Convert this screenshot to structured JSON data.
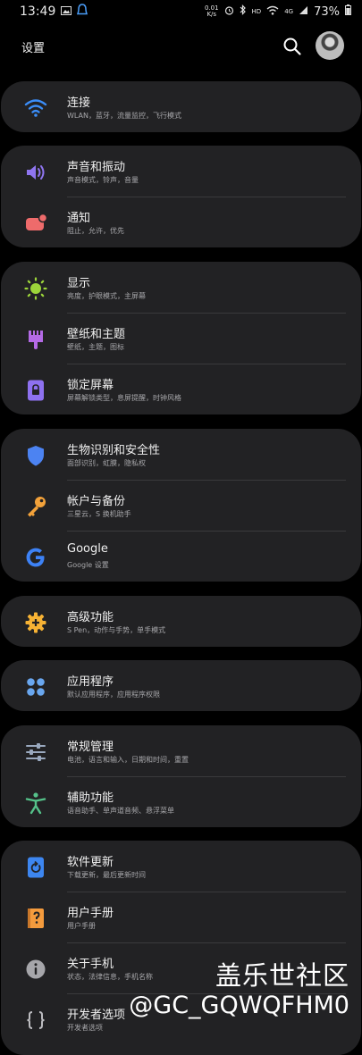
{
  "status_bar": {
    "time": "13:49",
    "net_speed_top": "0.01",
    "net_speed_bottom": "K/s",
    "hd": "HD",
    "signal": "4G",
    "battery": "73%"
  },
  "header": {
    "title": "设置"
  },
  "groups": [
    {
      "items": [
        {
          "label": "连接",
          "sub": "WLAN，蓝牙，流量监控，飞行模式",
          "icon": "wifi-icon",
          "color": "#3b8df7"
        }
      ]
    },
    {
      "items": [
        {
          "label": "声音和振动",
          "sub": "声音模式，铃声，音量",
          "icon": "volume-icon",
          "color": "#8f75f0"
        },
        {
          "label": "通知",
          "sub": "阻止，允许，优先",
          "icon": "notification-icon",
          "color": "#ee6b6b"
        }
      ]
    },
    {
      "items": [
        {
          "label": "显示",
          "sub": "亮度，护眼模式，主屏幕",
          "icon": "brightness-icon",
          "color": "#9cd53a"
        },
        {
          "label": "壁纸和主题",
          "sub": "壁纸，主题，图标",
          "icon": "paintbrush-icon",
          "color": "#b46ae6"
        },
        {
          "label": "锁定屏幕",
          "sub": "屏幕解锁类型，息屏提醒，时钟风格",
          "icon": "lock-icon",
          "color": "#8e71f0"
        }
      ]
    },
    {
      "items": [
        {
          "label": "生物识别和安全性",
          "sub": "面部识别，虹膜，隐私权",
          "icon": "shield-icon",
          "color": "#4c83f2"
        },
        {
          "label": "帐户与备份",
          "sub": "三星云，S 换机助手",
          "icon": "key-icon",
          "color": "#f3a23a"
        },
        {
          "label": "Google",
          "sub": "Google 设置",
          "icon": "google-icon",
          "color": "#3d82f6"
        }
      ]
    },
    {
      "items": [
        {
          "label": "高级功能",
          "sub": "S Pen，动作与手势，单手模式",
          "icon": "gear-plus-icon",
          "color": "#f6b234"
        }
      ]
    },
    {
      "items": [
        {
          "label": "应用程序",
          "sub": "默认应用程序，应用程序权限",
          "icon": "apps-icon",
          "color": "#69a6ee"
        }
      ]
    },
    {
      "items": [
        {
          "label": "常规管理",
          "sub": "电池，语言和输入，日期和时间，重置",
          "icon": "sliders-icon",
          "color": "#9aa9bf"
        },
        {
          "label": "辅助功能",
          "sub": "语音助手、单声道音频、悬浮菜单",
          "icon": "accessibility-icon",
          "color": "#55c28a"
        }
      ]
    },
    {
      "items": [
        {
          "label": "软件更新",
          "sub": "下载更新，最后更新时间",
          "icon": "update-icon",
          "color": "#3d86f0"
        },
        {
          "label": "用户手册",
          "sub": "用户手册",
          "icon": "manual-icon",
          "color": "#f49b3d"
        },
        {
          "label": "关于手机",
          "sub": "状态，法律信息，手机名称",
          "icon": "info-icon",
          "color": "#a6a6aa"
        },
        {
          "label": "开发者选项",
          "sub": "开发者选项",
          "icon": "developer-icon",
          "color": "#bcbcc0"
        }
      ]
    }
  ],
  "watermark": {
    "line1": "盖乐世社区",
    "line2": "@GC_GQWQFHM0"
  }
}
